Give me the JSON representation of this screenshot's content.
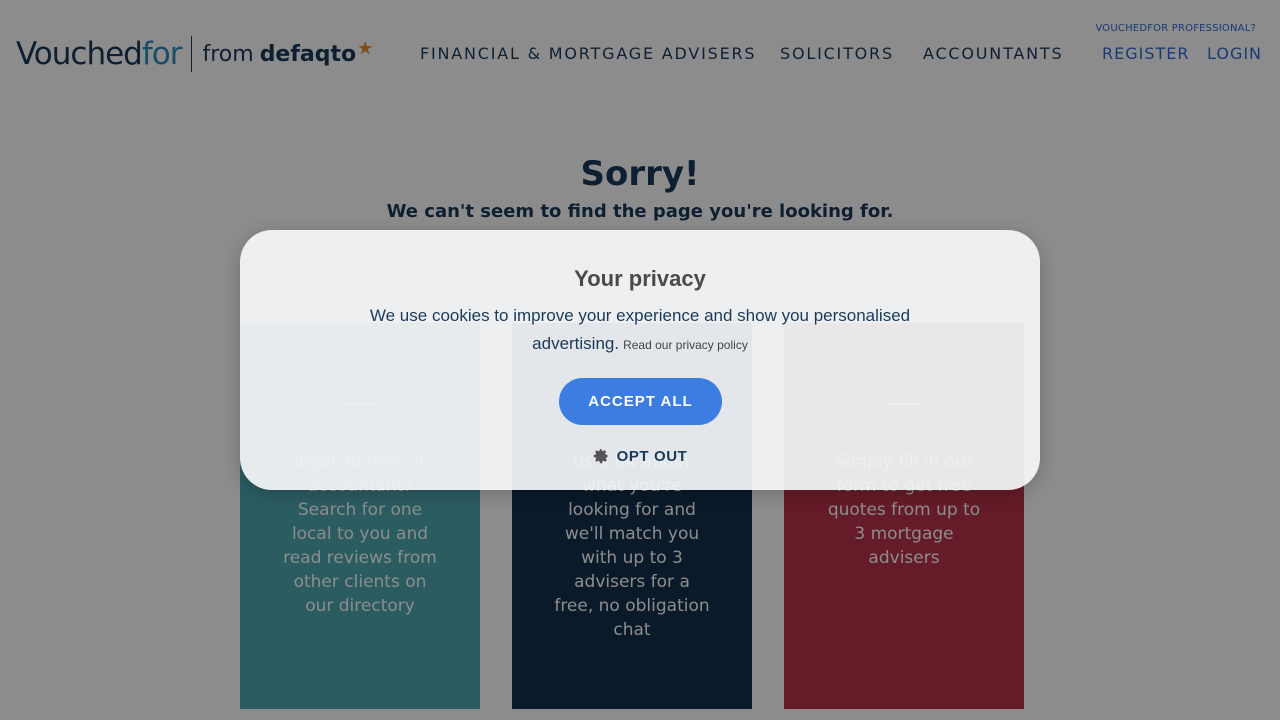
{
  "header": {
    "logo_main": "Vouched",
    "logo_accent": "for",
    "logo_from": "from",
    "logo_brand": "defaqto",
    "nav": [
      "FINANCIAL & MORTGAGE ADVISERS",
      "SOLICITORS",
      "ACCOUNTANTS"
    ],
    "pro_link": "VOUCHEDFOR PROFESSIONAL?",
    "register": "REGISTER",
    "login": "LOGIN"
  },
  "content": {
    "title": "Sorry!",
    "subtitle": "We can't seem to find the page you're looking for.",
    "cards": [
      {
        "body": "legal adviser or accountant? Search for one local to you and read reviews from other clients on our directory"
      },
      {
        "body": "us a bit about what you're looking for and we'll match you with up to 3 advisers for a free, no obligation chat"
      },
      {
        "body": "Simply fill in our form to get free quotes from up to 3 mortgage advisers"
      }
    ]
  },
  "modal": {
    "title": "Your privacy",
    "text": "We use cookies to improve your experience and show you personalised advertising.",
    "policy_link": "Read our privacy policy",
    "accept": "ACCEPT ALL",
    "opt_out": "OPT OUT"
  },
  "colors": {
    "navy": "#1b3a5a",
    "link_blue": "#2f6bd8",
    "button_blue": "#3b7de0",
    "teal": "#4fa8b2",
    "red": "#b8344a",
    "logo_accent": "#2c8fbf",
    "star": "#e98a2b"
  }
}
